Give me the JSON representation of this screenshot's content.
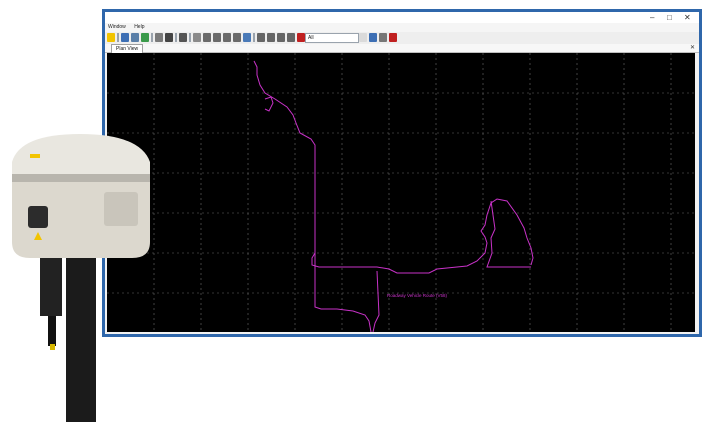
{
  "menu": {
    "items": [
      "Window",
      "Help"
    ]
  },
  "toolbar": {
    "combo_value": "All"
  },
  "tabs": [
    {
      "label": "Plan View"
    }
  ],
  "plot": {
    "annotation": "Roadway Vehicle Route (V58)"
  },
  "colors": {
    "frame": "#2f67ab",
    "background": "#000000",
    "trace": "#c832c8",
    "grid": "#6a6a6a"
  }
}
